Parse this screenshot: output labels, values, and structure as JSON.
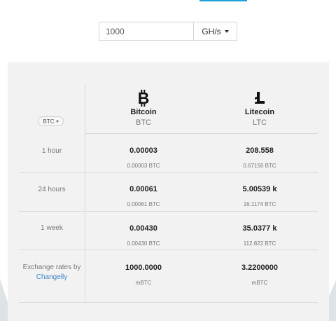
{
  "hashrate": {
    "value": "1000",
    "unit": "GH/s"
  },
  "table": {
    "currency_selector": "BTC",
    "coins": [
      {
        "name": "Bitcoin",
        "symbol": "BTC",
        "icon": "bitcoin-icon"
      },
      {
        "name": "Litecoin",
        "symbol": "LTC",
        "icon": "litecoin-icon"
      }
    ],
    "rows": [
      {
        "label": "1 hour",
        "btc": {
          "value": "0.00003",
          "sub": "0.00003 BTC"
        },
        "ltc": {
          "value": "208.558",
          "sub": "0.67156 BTC"
        }
      },
      {
        "label": "24 hours",
        "btc": {
          "value": "0.00061",
          "sub": "0.00061 BTC"
        },
        "ltc": {
          "value": "5.00539 k",
          "sub": "16.1174 BTC"
        }
      },
      {
        "label": "1 week",
        "btc": {
          "value": "0.00430",
          "sub": "0.00430 BTC"
        },
        "ltc": {
          "value": "35.0377 k",
          "sub": "112.822 BTC"
        }
      }
    ],
    "exchange": {
      "label": "Exchange rates by",
      "link": "Changelly",
      "btc": {
        "value": "1000.0000",
        "sub": "mBTC"
      },
      "ltc": {
        "value": "3.2200000",
        "sub": "mBTC"
      }
    }
  },
  "colors": {
    "accent": "#1e9fd6",
    "link": "#3c84c6",
    "panel": "#f2f2f2"
  }
}
